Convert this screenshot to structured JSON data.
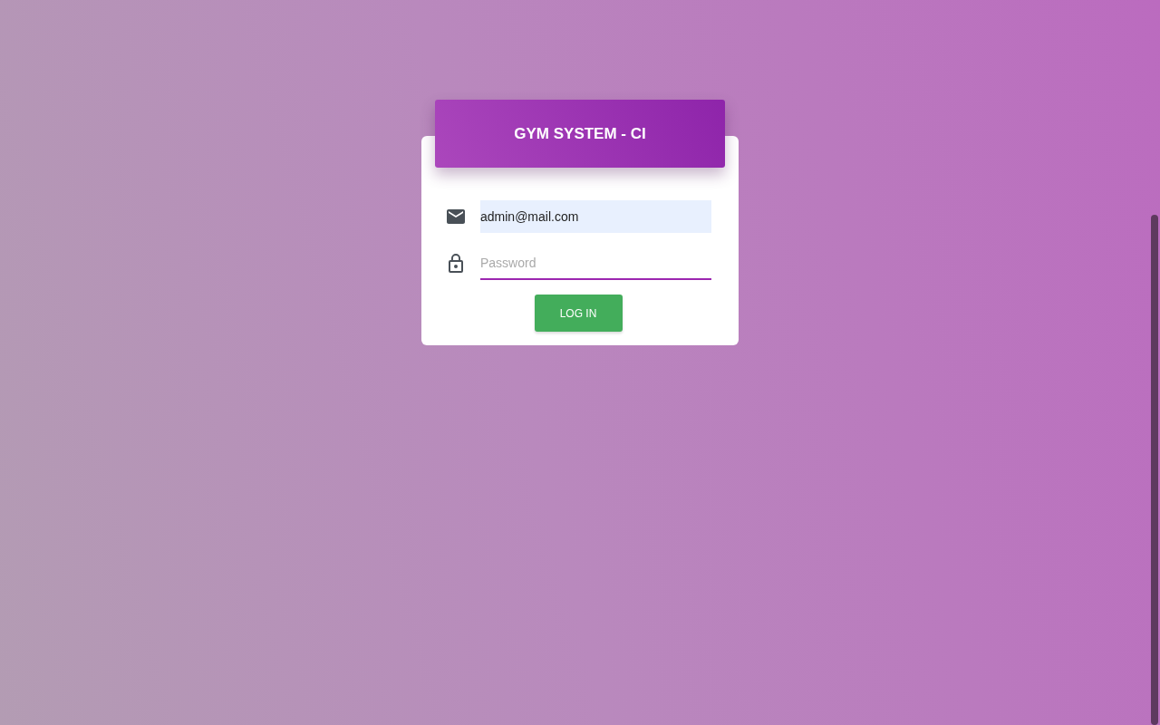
{
  "header": {
    "title": "GYM SYSTEM - CI"
  },
  "fields": [
    {
      "kind": "email",
      "value": "admin@mail.com",
      "autofilled": true,
      "focused": false
    },
    {
      "kind": "password",
      "placeholder": "Password",
      "autofilled": false,
      "focused": true
    }
  ],
  "button": {
    "label": "LOG IN"
  }
}
